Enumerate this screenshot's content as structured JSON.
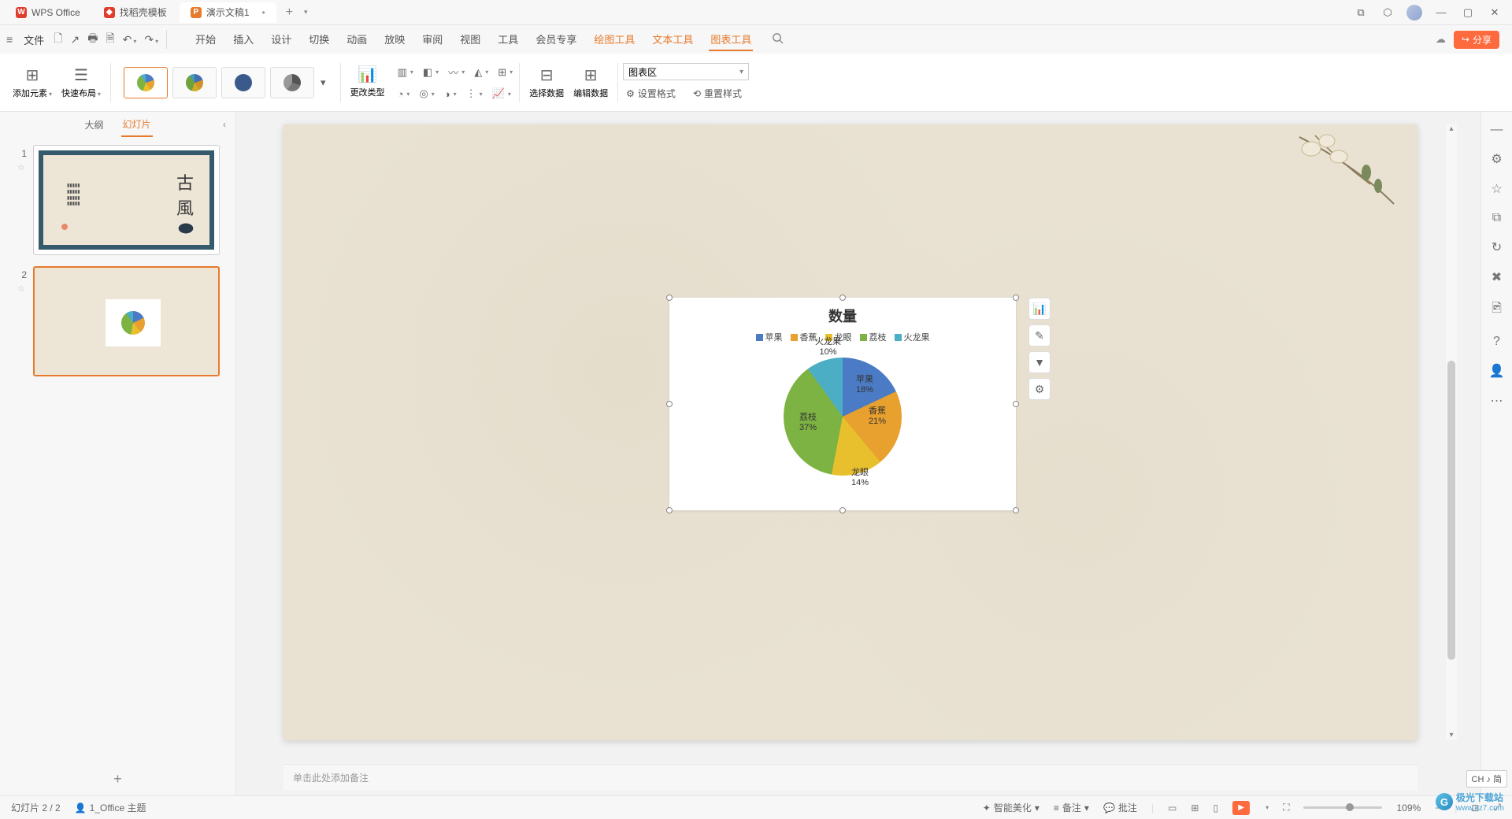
{
  "titlebar": {
    "tabs": [
      {
        "icon_bg": "#e03e2d",
        "icon_text": "W",
        "label": "WPS Office"
      },
      {
        "icon_bg": "#e03e2d",
        "icon_text": "◆",
        "label": "找稻壳模板"
      },
      {
        "icon_bg": "#e77b2d",
        "icon_text": "P",
        "label": "演示文稿1"
      }
    ]
  },
  "menubar": {
    "file": "文件",
    "tabs": [
      "开始",
      "插入",
      "设计",
      "切换",
      "动画",
      "放映",
      "审阅",
      "视图",
      "工具",
      "会员专享",
      "绘图工具",
      "文本工具",
      "图表工具"
    ],
    "active_indices": [
      10,
      11,
      12
    ],
    "underline_index": 12,
    "share": "分享"
  },
  "ribbon": {
    "add_element": "添加元素",
    "quick_layout": "快速布局",
    "change_type": "更改类型",
    "select_data": "选择数据",
    "edit_data": "编辑数据",
    "chart_area_select": "图表区",
    "set_format": "设置格式",
    "reset_style": "重置样式"
  },
  "left_panel": {
    "tabs": [
      "大纲",
      "幻灯片"
    ],
    "active": 1,
    "slides": [
      {
        "num": "1"
      },
      {
        "num": "2"
      }
    ]
  },
  "chart_data": {
    "type": "pie",
    "title": "数量",
    "categories": [
      "苹果",
      "香蕉",
      "龙眼",
      "荔枝",
      "火龙果"
    ],
    "values": [
      18,
      21,
      14,
      37,
      10
    ],
    "colors": [
      "#4b7bc5",
      "#e8a02e",
      "#e8c02e",
      "#7cb342",
      "#4baec5"
    ],
    "labels": [
      {
        "name": "苹果",
        "pct": "18%"
      },
      {
        "name": "香蕉",
        "pct": "21%"
      },
      {
        "name": "龙眼",
        "pct": "14%"
      },
      {
        "name": "荔枝",
        "pct": "37%"
      },
      {
        "name": "火龙果",
        "pct": "10%"
      }
    ]
  },
  "notes_placeholder": "单击此处添加备注",
  "statusbar": {
    "slide_pos": "幻灯片 2 / 2",
    "theme": "1_Office 主题",
    "smart_beautify": "智能美化",
    "notes": "备注",
    "comments": "批注",
    "zoom": "109%"
  },
  "ime": "CH ♪ 简",
  "watermark": {
    "text": "极光下载站",
    "url": "www.xz7.com"
  }
}
